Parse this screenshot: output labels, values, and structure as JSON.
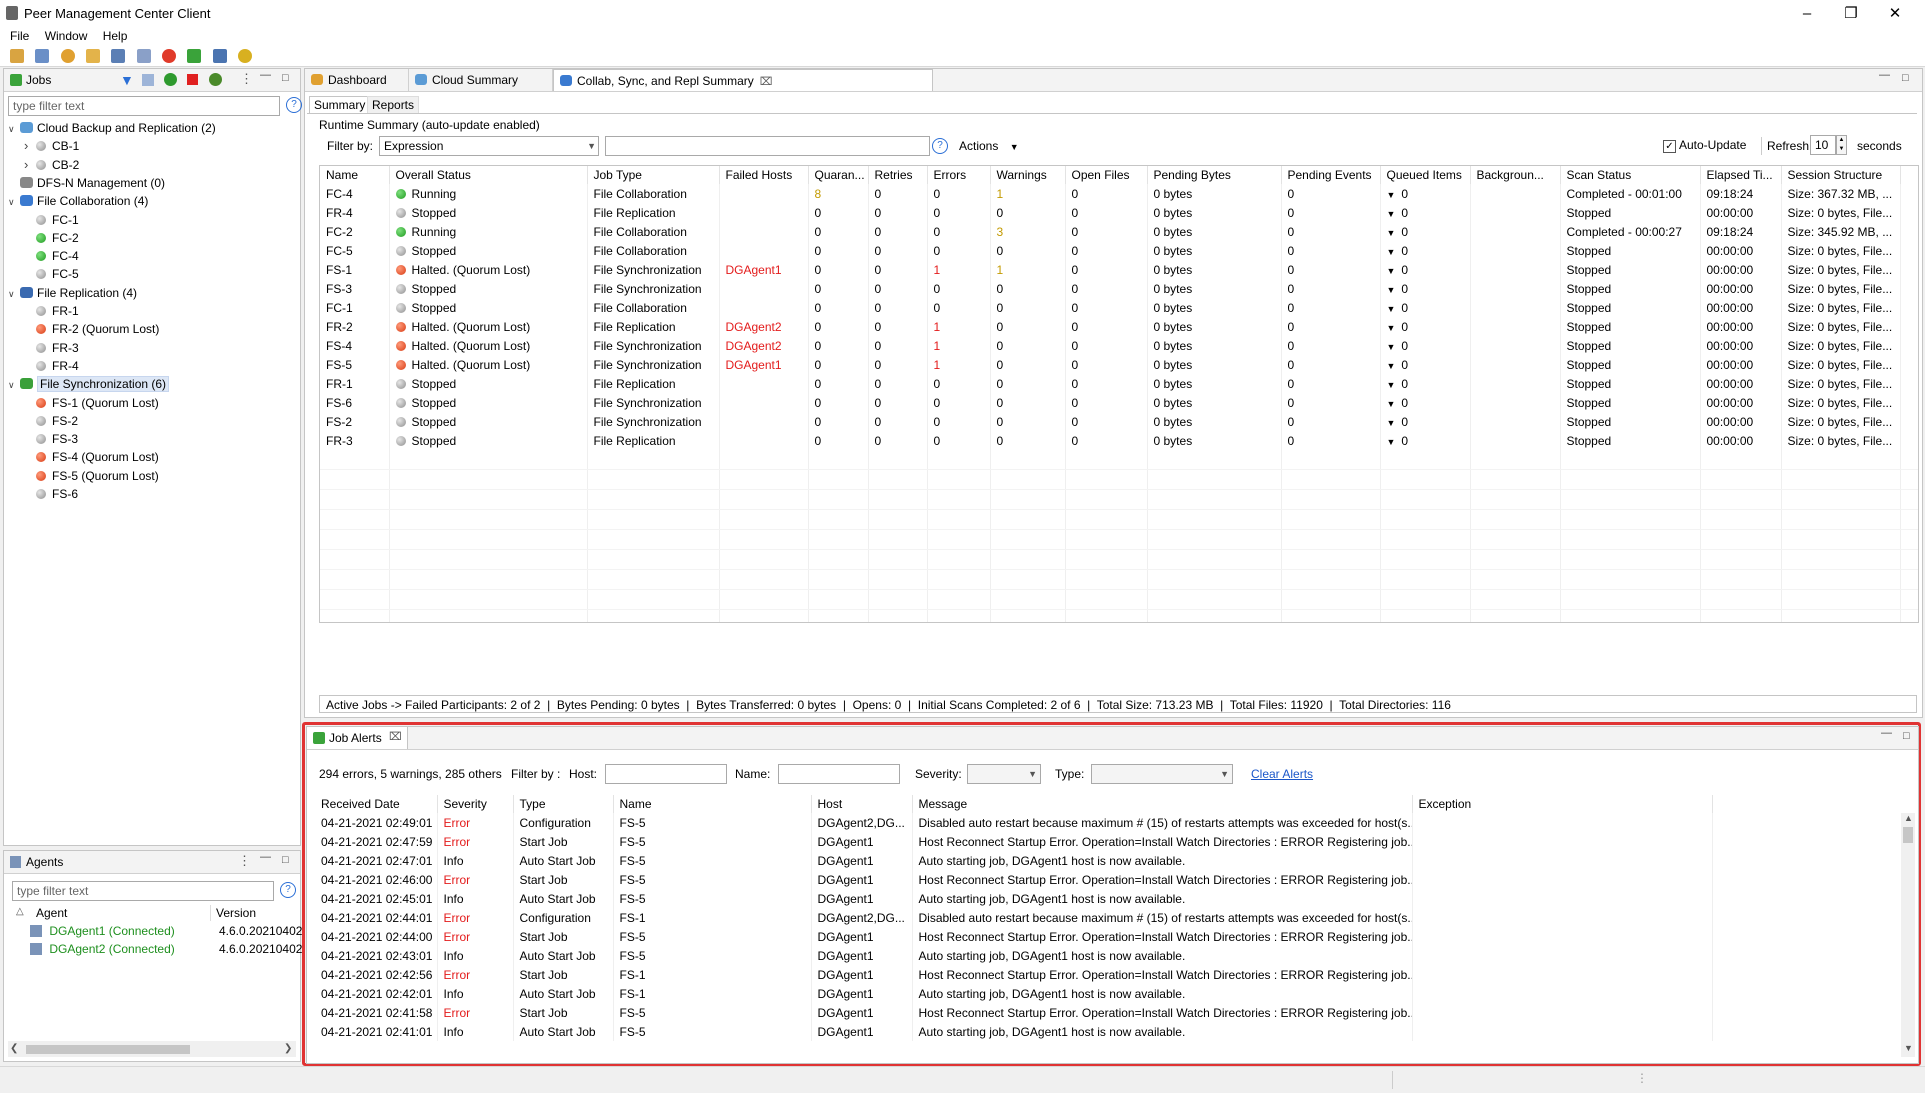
{
  "app": {
    "title": "Peer Management Center Client",
    "menu": [
      "File",
      "Window",
      "Help"
    ]
  },
  "jobs_panel": {
    "title": "Jobs",
    "filter_placeholder": "type filter text",
    "tree": [
      {
        "label": "Cloud Backup and Replication (2)",
        "level": 0,
        "expand": "v",
        "icon": "cloud-icon",
        "children": [
          {
            "label": "CB-1",
            "status": "grey",
            "expand": ">"
          },
          {
            "label": "CB-2",
            "status": "grey",
            "expand": ">"
          }
        ]
      },
      {
        "label": "DFS-N Management (0)",
        "level": 0,
        "expand": "",
        "icon": "dfs-icon",
        "children": []
      },
      {
        "label": "File Collaboration (4)",
        "level": 0,
        "expand": "v",
        "icon": "collab-icon",
        "children": [
          {
            "label": "FC-1",
            "status": "grey"
          },
          {
            "label": "FC-2",
            "status": "green"
          },
          {
            "label": "FC-4",
            "status": "green"
          },
          {
            "label": "FC-5",
            "status": "grey"
          }
        ]
      },
      {
        "label": "File Replication (4)",
        "level": 0,
        "expand": "v",
        "icon": "replication-icon",
        "children": [
          {
            "label": "FR-1",
            "status": "grey"
          },
          {
            "label": "FR-2 (Quorum Lost)",
            "status": "red"
          },
          {
            "label": "FR-3",
            "status": "grey"
          },
          {
            "label": "FR-4",
            "status": "grey"
          }
        ]
      },
      {
        "label": "File Synchronization (6)",
        "level": 0,
        "expand": "v",
        "icon": "sync-icon",
        "selected": true,
        "children": [
          {
            "label": "FS-1 (Quorum Lost)",
            "status": "red"
          },
          {
            "label": "FS-2",
            "status": "grey"
          },
          {
            "label": "FS-3",
            "status": "grey"
          },
          {
            "label": "FS-4 (Quorum Lost)",
            "status": "red"
          },
          {
            "label": "FS-5 (Quorum Lost)",
            "status": "red"
          },
          {
            "label": "FS-6",
            "status": "grey"
          }
        ]
      }
    ]
  },
  "agents_panel": {
    "title": "Agents",
    "filter_placeholder": "type filter text",
    "columns": [
      "Agent",
      "Version"
    ],
    "rows": [
      {
        "agent": "DGAgent1 (Connected)",
        "version": "4.6.0.20210402"
      },
      {
        "agent": "DGAgent2 (Connected)",
        "version": "4.6.0.20210402"
      }
    ]
  },
  "editor_tabs": [
    {
      "label": "Dashboard",
      "icon": "dashboard-icon"
    },
    {
      "label": "Cloud Summary",
      "icon": "cloud-icon"
    },
    {
      "label": "Collab, Sync, and Repl Summary",
      "icon": "collab-icon",
      "active": true
    }
  ],
  "summary": {
    "subtabs": [
      "Summary",
      "Reports"
    ],
    "runtime_label": "Runtime Summary (auto-update enabled)",
    "filter_label": "Filter by:",
    "filter_value": "Expression",
    "actions_label": "Actions",
    "auto_update_label": "Auto-Update",
    "refresh_label": "Refresh",
    "refresh_value": "10",
    "seconds_label": "seconds",
    "columns": [
      "Name",
      "Overall Status",
      "Job Type",
      "Failed Hosts",
      "Quaran...",
      "Retries",
      "Errors",
      "Warnings",
      "Open Files",
      "Pending Bytes",
      "Pending Events",
      "Queued Items",
      "Backgroun...",
      "Scan Status",
      "Elapsed Ti...",
      "Session Structure"
    ],
    "rows": [
      [
        "FC-4",
        "green",
        "Running",
        "File Collaboration",
        "",
        "8",
        "0",
        "0",
        "1",
        "0",
        "0 bytes",
        "0",
        "",
        "0",
        "Completed - 00:01:00",
        "09:18:24",
        "Size: 367.32 MB, ..."
      ],
      [
        "FR-4",
        "grey",
        "Stopped",
        "File Replication",
        "",
        "0",
        "0",
        "0",
        "0",
        "0",
        "0 bytes",
        "0",
        "v",
        "0",
        "Stopped",
        "00:00:00",
        "Size: 0 bytes, File..."
      ],
      [
        "FC-2",
        "green",
        "Running",
        "File Collaboration",
        "",
        "0",
        "0",
        "0",
        "3",
        "0",
        "0 bytes",
        "0",
        "v",
        "0",
        "Completed - 00:00:27",
        "09:18:24",
        "Size: 345.92 MB, ..."
      ],
      [
        "FC-5",
        "grey",
        "Stopped",
        "File Collaboration",
        "",
        "0",
        "0",
        "0",
        "0",
        "0",
        "0 bytes",
        "0",
        "v",
        "0",
        "Stopped",
        "00:00:00",
        "Size: 0 bytes, File..."
      ],
      [
        "FS-1",
        "red",
        "Halted. (Quorum Lost)",
        "File Synchronization",
        "DGAgent1",
        "0",
        "0",
        "1",
        "1",
        "0",
        "0 bytes",
        "0",
        "v",
        "0",
        "Stopped",
        "00:00:00",
        "Size: 0 bytes, File..."
      ],
      [
        "FS-3",
        "grey",
        "Stopped",
        "File Synchronization",
        "",
        "0",
        "0",
        "0",
        "0",
        "0",
        "0 bytes",
        "0",
        "v",
        "0",
        "Stopped",
        "00:00:00",
        "Size: 0 bytes, File..."
      ],
      [
        "FC-1",
        "grey",
        "Stopped",
        "File Collaboration",
        "",
        "0",
        "0",
        "0",
        "0",
        "0",
        "0 bytes",
        "0",
        "v",
        "0",
        "Stopped",
        "00:00:00",
        "Size: 0 bytes, File..."
      ],
      [
        "FR-2",
        "red",
        "Halted. (Quorum Lost)",
        "File Replication",
        "DGAgent2",
        "0",
        "0",
        "1",
        "0",
        "0",
        "0 bytes",
        "0",
        "v",
        "0",
        "Stopped",
        "00:00:00",
        "Size: 0 bytes, File..."
      ],
      [
        "FS-4",
        "red",
        "Halted. (Quorum Lost)",
        "File Synchronization",
        "DGAgent2",
        "0",
        "0",
        "1",
        "0",
        "0",
        "0 bytes",
        "0",
        "v",
        "0",
        "Stopped",
        "00:00:00",
        "Size: 0 bytes, File..."
      ],
      [
        "FS-5",
        "red",
        "Halted. (Quorum Lost)",
        "File Synchronization",
        "DGAgent1",
        "0",
        "0",
        "1",
        "0",
        "0",
        "0 bytes",
        "0",
        "v",
        "0",
        "Stopped",
        "00:00:00",
        "Size: 0 bytes, File..."
      ],
      [
        "FR-1",
        "grey",
        "Stopped",
        "File Replication",
        "",
        "0",
        "0",
        "0",
        "0",
        "0",
        "0 bytes",
        "0",
        "v",
        "0",
        "Stopped",
        "00:00:00",
        "Size: 0 bytes, File..."
      ],
      [
        "FS-6",
        "grey",
        "Stopped",
        "File Synchronization",
        "",
        "0",
        "0",
        "0",
        "0",
        "0",
        "0 bytes",
        "0",
        "v",
        "0",
        "Stopped",
        "00:00:00",
        "Size: 0 bytes, File..."
      ],
      [
        "FS-2",
        "grey",
        "Stopped",
        "File Synchronization",
        "",
        "0",
        "0",
        "0",
        "0",
        "0",
        "0 bytes",
        "0",
        "v",
        "0",
        "Stopped",
        "00:00:00",
        "Size: 0 bytes, File..."
      ],
      [
        "FR-3",
        "grey",
        "Stopped",
        "File Replication",
        "",
        "0",
        "0",
        "0",
        "0",
        "0",
        "0 bytes",
        "0",
        "v",
        "0",
        "Stopped",
        "00:00:00",
        "Size: 0 bytes, File..."
      ]
    ],
    "status_bar": "Active Jobs -> Failed Participants: 2 of 2  |  Bytes Pending: 0 bytes  |  Bytes Transferred: 0 bytes  |  Opens: 0  |  Initial Scans Completed: 2 of 6  |  Total Size: 713.23 MB  |  Total Files: 11920  |  Total Directories: 116"
  },
  "alerts": {
    "title": "Job Alerts",
    "summary": "294 errors, 5 warnings, 285 others",
    "filter_by": "Filter by :",
    "host_label": "Host:",
    "name_label": "Name:",
    "severity_label": "Severity:",
    "type_label": "Type:",
    "clear_label": "Clear Alerts",
    "columns": [
      "Received Date",
      "Severity",
      "Type",
      "Name",
      "Host",
      "Message",
      "Exception"
    ],
    "rows": [
      [
        "04-21-2021 02:49:01",
        "Error",
        "Configuration",
        "FS-5",
        "DGAgent2,DG...",
        "Disabled auto restart because maximum # (15) of restarts attempts was exceeded for host(s..."
      ],
      [
        "04-21-2021 02:47:59",
        "Error",
        "Start Job",
        "FS-5",
        "DGAgent1",
        "Host Reconnect Startup Error.  Operation=Install Watch Directories : ERROR Registering job..."
      ],
      [
        "04-21-2021 02:47:01",
        "Info",
        "Auto Start Job",
        "FS-5",
        "DGAgent1",
        "Auto starting job, DGAgent1 host is now available."
      ],
      [
        "04-21-2021 02:46:00",
        "Error",
        "Start Job",
        "FS-5",
        "DGAgent1",
        "Host Reconnect Startup Error.  Operation=Install Watch Directories : ERROR Registering job..."
      ],
      [
        "04-21-2021 02:45:01",
        "Info",
        "Auto Start Job",
        "FS-5",
        "DGAgent1",
        "Auto starting job, DGAgent1 host is now available."
      ],
      [
        "04-21-2021 02:44:01",
        "Error",
        "Configuration",
        "FS-1",
        "DGAgent2,DG...",
        "Disabled auto restart because maximum # (15) of restarts attempts was exceeded for host(s..."
      ],
      [
        "04-21-2021 02:44:00",
        "Error",
        "Start Job",
        "FS-5",
        "DGAgent1",
        "Host Reconnect Startup Error.  Operation=Install Watch Directories : ERROR Registering job..."
      ],
      [
        "04-21-2021 02:43:01",
        "Info",
        "Auto Start Job",
        "FS-5",
        "DGAgent1",
        "Auto starting job, DGAgent1 host is now available."
      ],
      [
        "04-21-2021 02:42:56",
        "Error",
        "Start Job",
        "FS-1",
        "DGAgent1",
        "Host Reconnect Startup Error.  Operation=Install Watch Directories : ERROR Registering job..."
      ],
      [
        "04-21-2021 02:42:01",
        "Info",
        "Auto Start Job",
        "FS-1",
        "DGAgent1",
        "Auto starting job, DGAgent1 host is now available."
      ],
      [
        "04-21-2021 02:41:58",
        "Error",
        "Start Job",
        "FS-5",
        "DGAgent1",
        "Host Reconnect Startup Error.  Operation=Install Watch Directories : ERROR Registering job..."
      ],
      [
        "04-21-2021 02:41:01",
        "Info",
        "Auto Start Job",
        "FS-5",
        "DGAgent1",
        "Auto starting job, DGAgent1 host is now available."
      ]
    ]
  },
  "colors": {
    "highlight_border": "#e03333",
    "error_text": "#e31b1b",
    "agent_connected": "#1e8f1e",
    "link": "#1a56c9"
  }
}
